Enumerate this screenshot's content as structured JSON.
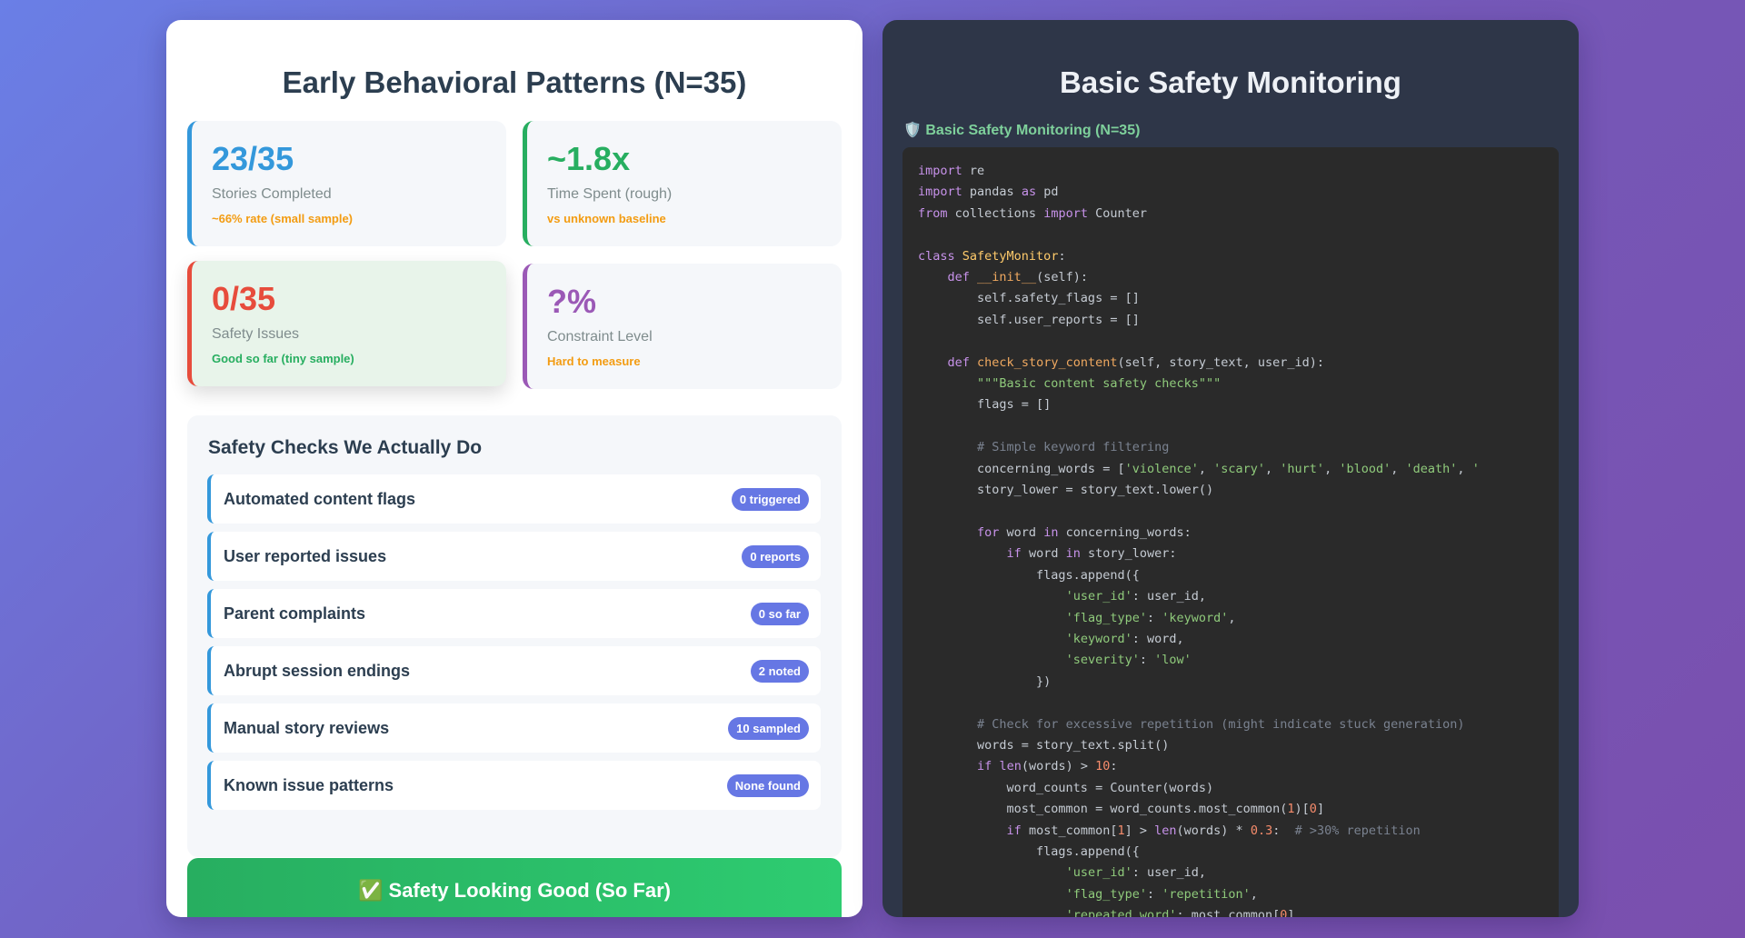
{
  "left_panel": {
    "title": "Early Behavioral Patterns (N=35)",
    "metrics": [
      {
        "value": "23/35",
        "label": "Stories Completed",
        "note": "~66% rate (small sample)"
      },
      {
        "value": "~1.8x",
        "label": "Time Spent (rough)",
        "note": "vs unknown baseline"
      },
      {
        "value": "0/35",
        "label": "Safety Issues",
        "note": "Good so far (tiny sample)"
      },
      {
        "value": "?%",
        "label": "Constraint Level",
        "note": "Hard to measure"
      }
    ],
    "checks": {
      "title": "Safety Checks We Actually Do",
      "items": [
        {
          "label": "Automated content flags",
          "badge": "0 triggered"
        },
        {
          "label": "User reported issues",
          "badge": "0 reports"
        },
        {
          "label": "Parent complaints",
          "badge": "0 so far"
        },
        {
          "label": "Abrupt session endings",
          "badge": "2 noted"
        },
        {
          "label": "Manual story reviews",
          "badge": "10 sampled"
        },
        {
          "label": "Known issue patterns",
          "badge": "None found"
        }
      ]
    },
    "status_banner": "✅ Safety Looking Good (So Far)"
  },
  "right_panel": {
    "title": "Basic Safety Monitoring",
    "code_caption": "🛡️ Basic Safety Monitoring (N=35)",
    "code_lines": [
      "import re",
      "import pandas as pd",
      "from collections import Counter",
      "",
      "class SafetyMonitor:",
      "    def __init__(self):",
      "        self.safety_flags = []",
      "        self.user_reports = []",
      "",
      "    def check_story_content(self, story_text, user_id):",
      "        \"\"\"Basic content safety checks\"\"\"",
      "        flags = []",
      "",
      "        # Simple keyword filtering",
      "        concerning_words = ['violence', 'scary', 'hurt', 'blood', 'death', '",
      "        story_lower = story_text.lower()",
      "",
      "        for word in concerning_words:",
      "            if word in story_lower:",
      "                flags.append({",
      "                    'user_id': user_id,",
      "                    'flag_type': 'keyword',",
      "                    'keyword': word,",
      "                    'severity': 'low'",
      "                })",
      "",
      "        # Check for excessive repetition (might indicate stuck generation)",
      "        words = story_text.split()",
      "        if len(words) > 10:",
      "            word_counts = Counter(words)",
      "            most_common = word_counts.most_common(1)[0]",
      "            if most_common[1] > len(words) * 0.3:  # >30% repetition",
      "                flags.append({",
      "                    'user_id': user_id,",
      "                    'flag_type': 'repetition',",
      "                    'repeated_word': most_common[0],"
    ]
  }
}
